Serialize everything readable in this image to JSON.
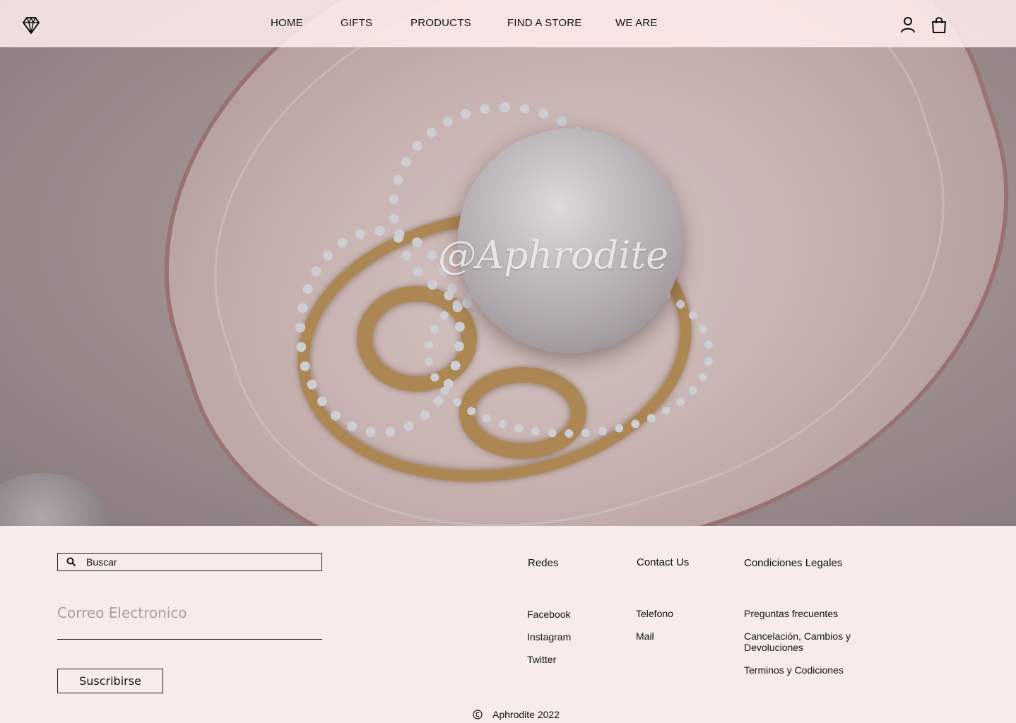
{
  "brand": {
    "watermark": "@Aphrodite"
  },
  "nav": {
    "home": "HOME",
    "gifts": "GIFTS",
    "products": "PRODUCTS",
    "find_store": "FIND A STORE",
    "we_are": "WE ARE"
  },
  "header_icons": [
    "diamond-logo-icon",
    "user-icon",
    "shopping-bag-icon"
  ],
  "footer": {
    "search_placeholder": "Buscar",
    "email_placeholder": "Correo Electronico",
    "subscribe_label": "Suscribirse",
    "columns": {
      "redes": {
        "title": "Redes",
        "links": [
          "Facebook",
          "Instagram",
          "Twitter"
        ]
      },
      "contact": {
        "title": "Contact Us",
        "links": [
          "Telefono",
          "Mail"
        ]
      },
      "legal": {
        "title": "Condiciones Legales",
        "links": [
          "Preguntas frecuentes",
          "Cancelación, Cambios y Devoluciones",
          "Terminos y Codiciones"
        ]
      }
    },
    "copyright": "Aphrodite 2022"
  },
  "colors": {
    "header_bg": "#fae8e8",
    "footer_bg": "#f7ecea",
    "gold": "#c69a5a"
  }
}
